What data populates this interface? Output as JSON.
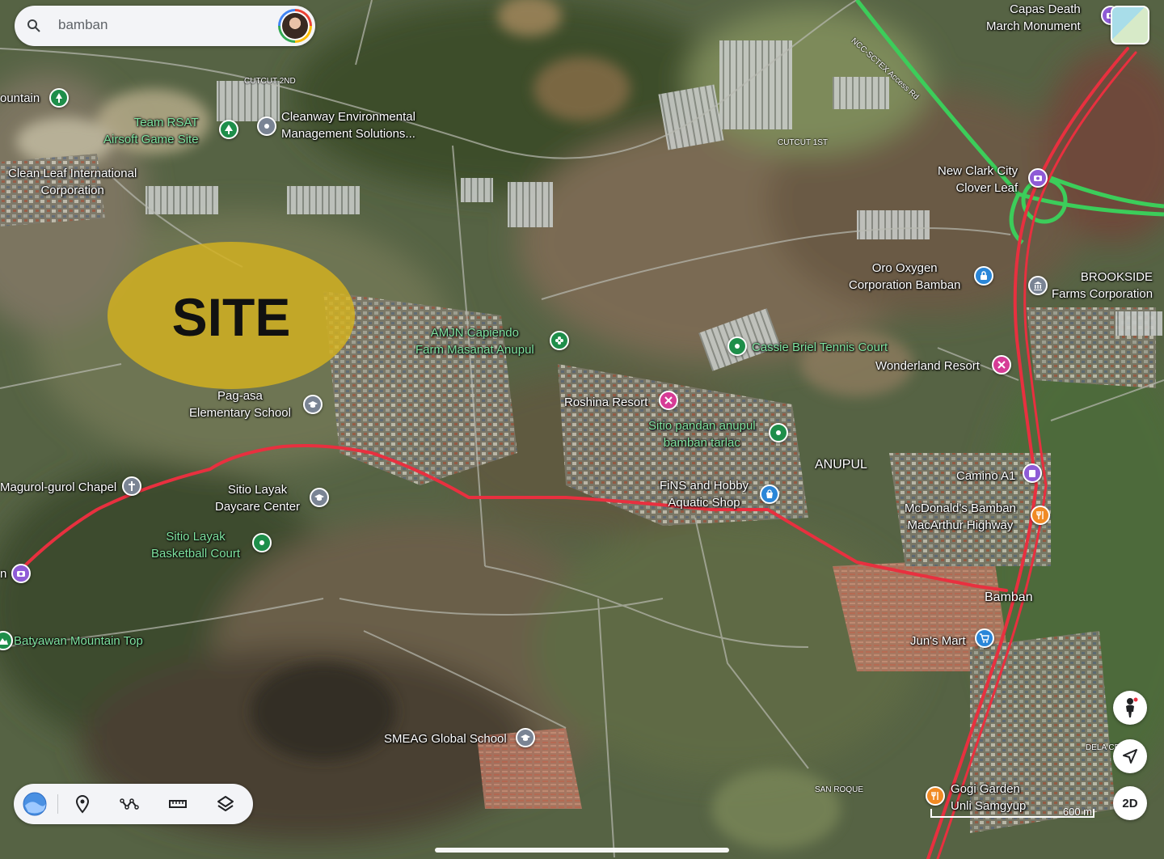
{
  "search": {
    "query": "bamban"
  },
  "site_label": "SITE",
  "colors": {
    "site_highlight": "#d4b21f",
    "route": "#e8303f",
    "expressway": "#3ccd5a",
    "pin_green": "#1e8e4a",
    "pin_pink": "#d63c96",
    "pin_blue": "#2a86d8",
    "pin_gray": "#7a8494",
    "pin_orange": "#f08a24",
    "pin_purple": "#8e5bd6"
  },
  "places": {
    "capas": "Capas Death\nMarch Monument",
    "mountain": "ountain",
    "team_rsat": "Team RSAT\nAirsoft Game Site",
    "cleanway": "Cleanway Environmental\nManagement Solutions...",
    "clean_leaf": "Clean Leaf International\nCorporation",
    "new_clark": "New Clark City\nClover Leaf",
    "oro_oxygen": "Oro Oxygen\nCorporation Bamban",
    "brookside": "BROOKSIDE\nFarms Corporation",
    "amjn": "AMJN Capiendo\nFarm Masanat Anupul",
    "cassie": "Cassie Briel Tennis Court",
    "wonderland": "Wonderland Resort",
    "pag_asa": "Pag-asa\nElementary School",
    "roshina": "Roshina Resort",
    "sitio_pandan": "Sitio pandan anupul\nbamban tarlac",
    "anupul": "ANUPUL",
    "magurol": "Magurol-gurol Chapel",
    "sitio_layak_daycare": "Sitio Layak\nDaycare Center",
    "fins": "FiNS and Hobby\nAquatic Shop",
    "camino": "Camino A1",
    "mcdonalds": "McDonald's Bamban\nMacArthur Highway",
    "sitio_layak_court": "Sitio Layak\nBasketball Court",
    "bamban": "Bamban",
    "left_edge": "n",
    "batyawan": "Batyawan Mountain Top",
    "juns_mart": "Jun's Mart",
    "smeag": "SMEAG Global School",
    "gogi": "Gogi Garden\nUnli Samgyup"
  },
  "road_labels": {
    "cutcut2": "CUTCUT 2ND",
    "cutcut1": "CUTCUT 1ST",
    "nlex": "NCC-SCTEX Access Rd",
    "san_roque": "SAN ROQUE",
    "dela": "DELA CR"
  },
  "scale": {
    "label": "600 m"
  },
  "controls": {
    "view_mode": "2D"
  },
  "toolbar": {
    "icons": [
      "earth-icon",
      "pin-icon",
      "route-icon",
      "ruler-icon",
      "layers-icon"
    ]
  }
}
